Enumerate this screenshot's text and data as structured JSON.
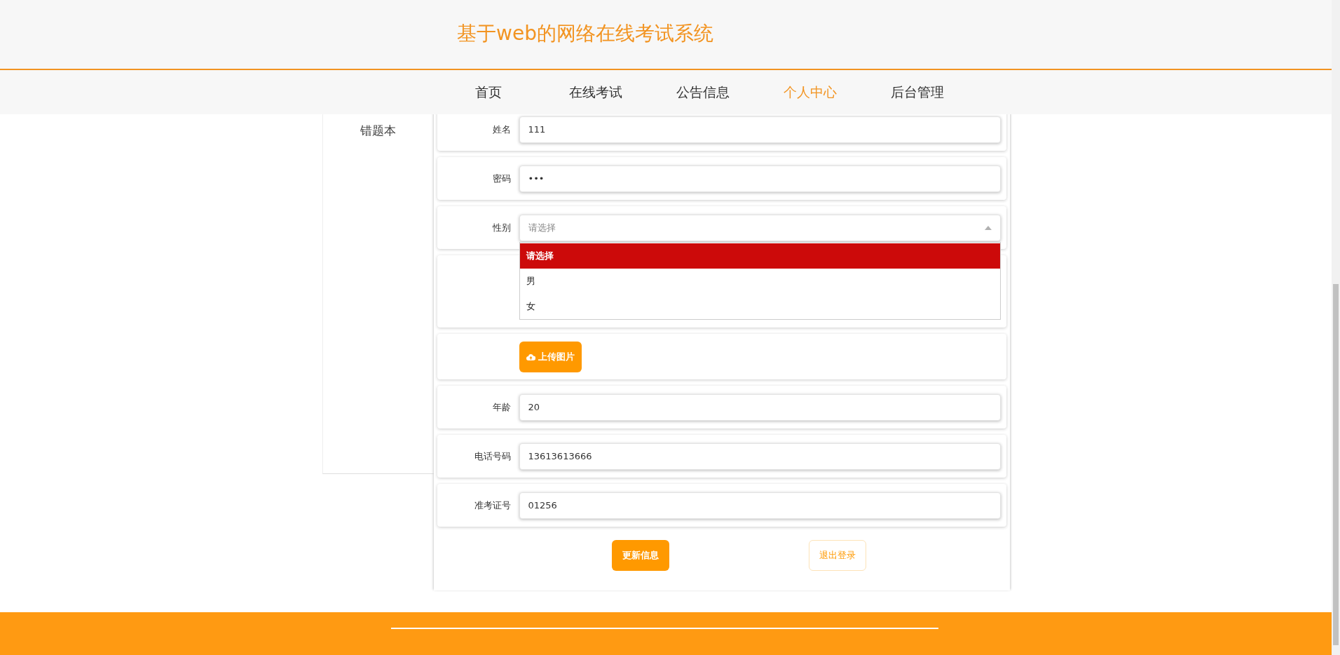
{
  "header": {
    "title": "基于web的网络在线考试系统"
  },
  "nav": [
    {
      "label": "首页",
      "selected": false
    },
    {
      "label": "在线考试",
      "selected": false
    },
    {
      "label": "公告信息",
      "selected": false
    },
    {
      "label": "个人中心",
      "selected": true
    },
    {
      "label": "后台管理",
      "selected": false
    }
  ],
  "sidebar": {
    "items": [
      {
        "label": "错题本"
      }
    ]
  },
  "form": {
    "fields": [
      {
        "kind": "text",
        "label": "姓名",
        "value": "111"
      },
      {
        "kind": "text",
        "label": "密码",
        "value": "•••"
      },
      {
        "kind": "select",
        "label": "性别",
        "placeholder": "请选择",
        "expanded": true,
        "options": [
          {
            "label": "请选择",
            "selected": true
          },
          {
            "label": "男",
            "selected": false
          },
          {
            "label": "女",
            "selected": false
          }
        ]
      },
      {
        "kind": "image"
      },
      {
        "kind": "upload",
        "button": "上传图片"
      },
      {
        "kind": "text",
        "label": "年龄",
        "value": "20"
      },
      {
        "kind": "text",
        "label": "电话号码",
        "value": "13613613666"
      },
      {
        "kind": "text",
        "label": "准考证号",
        "value": "01256"
      }
    ],
    "buttons": [
      {
        "kind": "primary",
        "label": "更新信息"
      },
      {
        "kind": "outline",
        "label": "退出登录"
      }
    ]
  }
}
